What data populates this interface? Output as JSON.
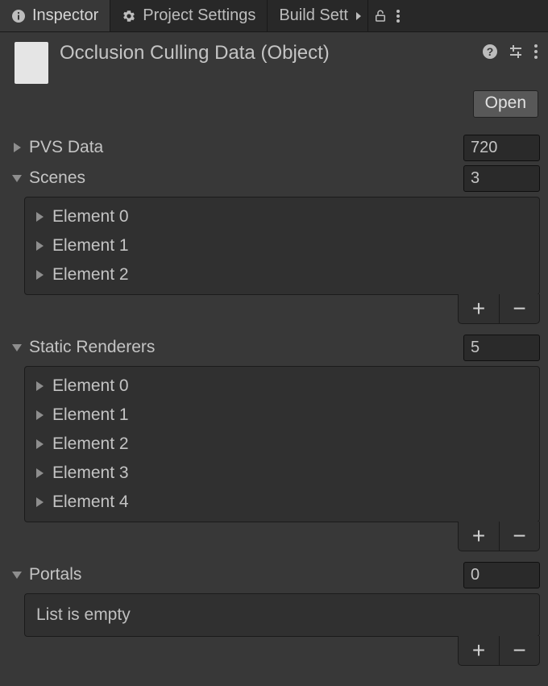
{
  "tabs": {
    "inspector": "Inspector",
    "project_settings": "Project Settings",
    "build_settings_truncated": "Build Sett"
  },
  "header": {
    "title": "Occlusion Culling Data (Object)",
    "open_button": "Open"
  },
  "pvs": {
    "label": "PVS Data",
    "value": "720"
  },
  "scenes": {
    "label": "Scenes",
    "count": "3",
    "items": [
      "Element 0",
      "Element 1",
      "Element 2"
    ]
  },
  "static_renderers": {
    "label": "Static Renderers",
    "count": "5",
    "items": [
      "Element 0",
      "Element 1",
      "Element 2",
      "Element 3",
      "Element 4"
    ]
  },
  "portals": {
    "label": "Portals",
    "count": "0",
    "empty_text": "List is empty"
  },
  "buttons": {
    "add": "+",
    "remove": "−"
  }
}
